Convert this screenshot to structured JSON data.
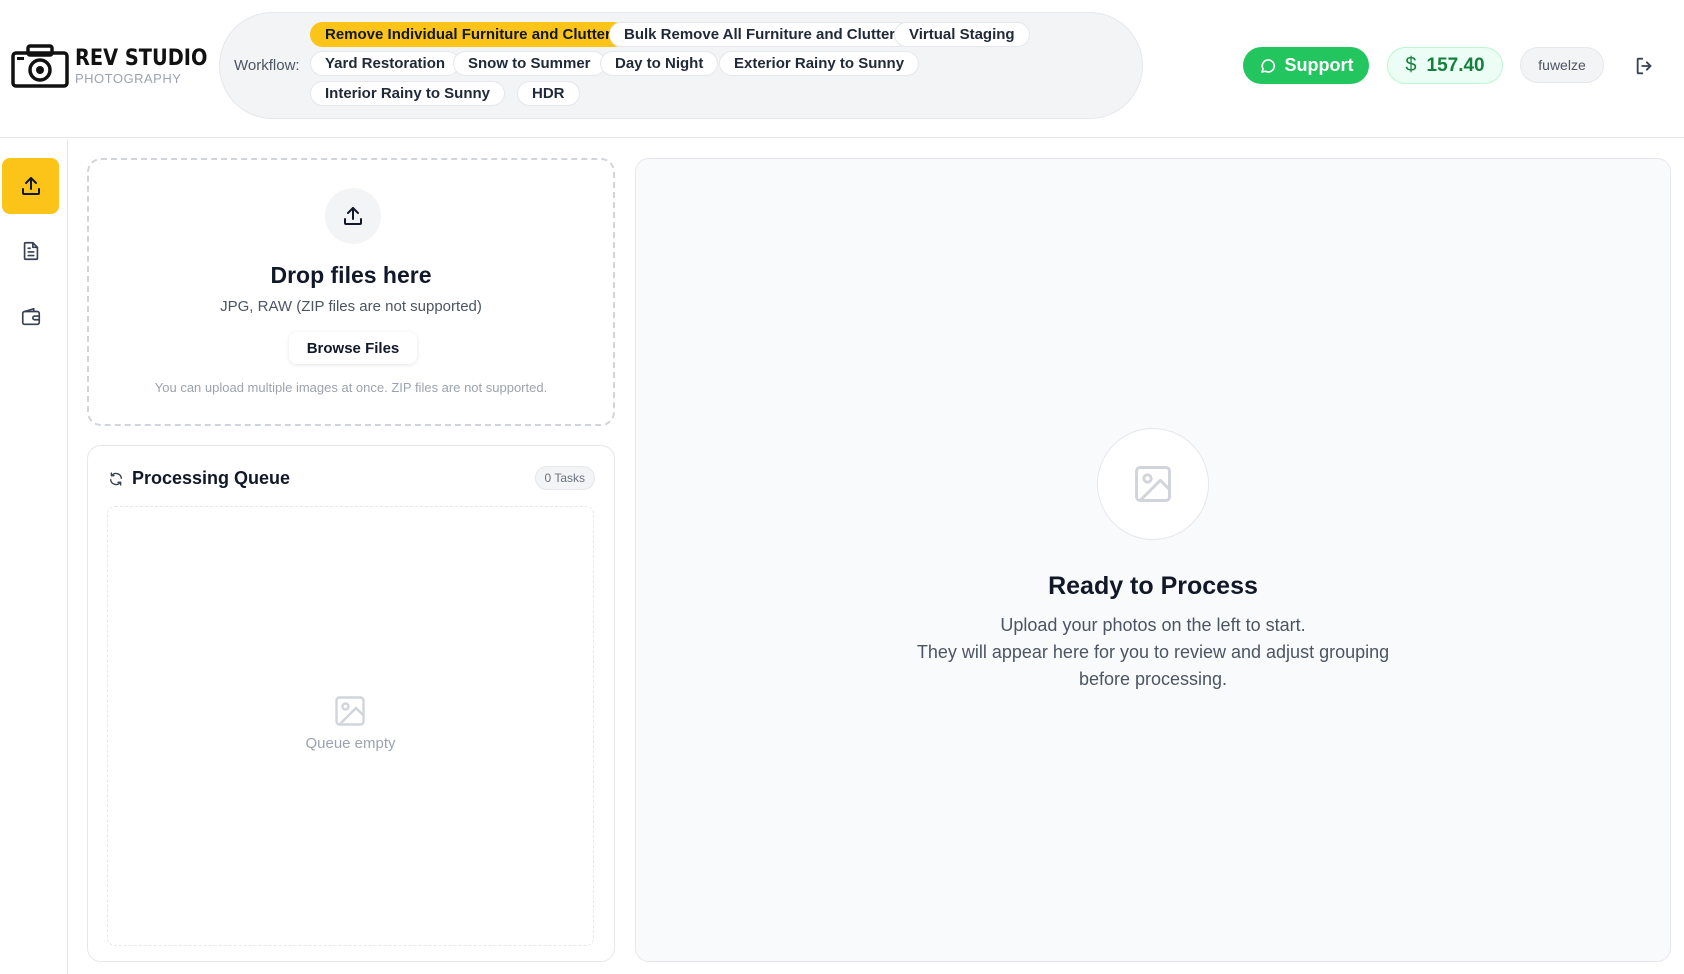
{
  "brand": {
    "name": "REV STUDIO",
    "sub": "PHOTOGRAPHY"
  },
  "workflow": {
    "label": "Workflow:",
    "options": [
      "Remove Individual Furniture and Clutter",
      "Bulk Remove All Furniture and Clutter",
      "Virtual Staging",
      "Yard Restoration",
      "Snow to Summer",
      "Day to Night",
      "Exterior Rainy to Sunny",
      "Interior Rainy to Sunny",
      "HDR"
    ],
    "active_index": 0
  },
  "header": {
    "support_label": "Support",
    "balance_symbol": "$",
    "balance": "157.40",
    "username": "fuwelze"
  },
  "sidebar": {
    "items": [
      {
        "icon": "upload-icon",
        "active": true
      },
      {
        "icon": "document-icon",
        "active": false
      },
      {
        "icon": "wallet-icon",
        "active": false
      }
    ]
  },
  "upload": {
    "title": "Drop files here",
    "subtitle": "JPG, RAW (ZIP files are not supported)",
    "browse_label": "Browse Files",
    "note": "You can upload multiple images at once. ZIP files are not supported."
  },
  "queue": {
    "title": "Processing Queue",
    "task_count": "0 Tasks",
    "empty_text": "Queue empty"
  },
  "preview": {
    "title": "Ready to Process",
    "line1": "Upload your photos on the left to start.",
    "line2": "They will appear here for you to review and adjust grouping",
    "line3": "before processing."
  },
  "colors": {
    "accent": "#fcc419",
    "support": "#22c55e",
    "balance_text": "#15803d"
  }
}
